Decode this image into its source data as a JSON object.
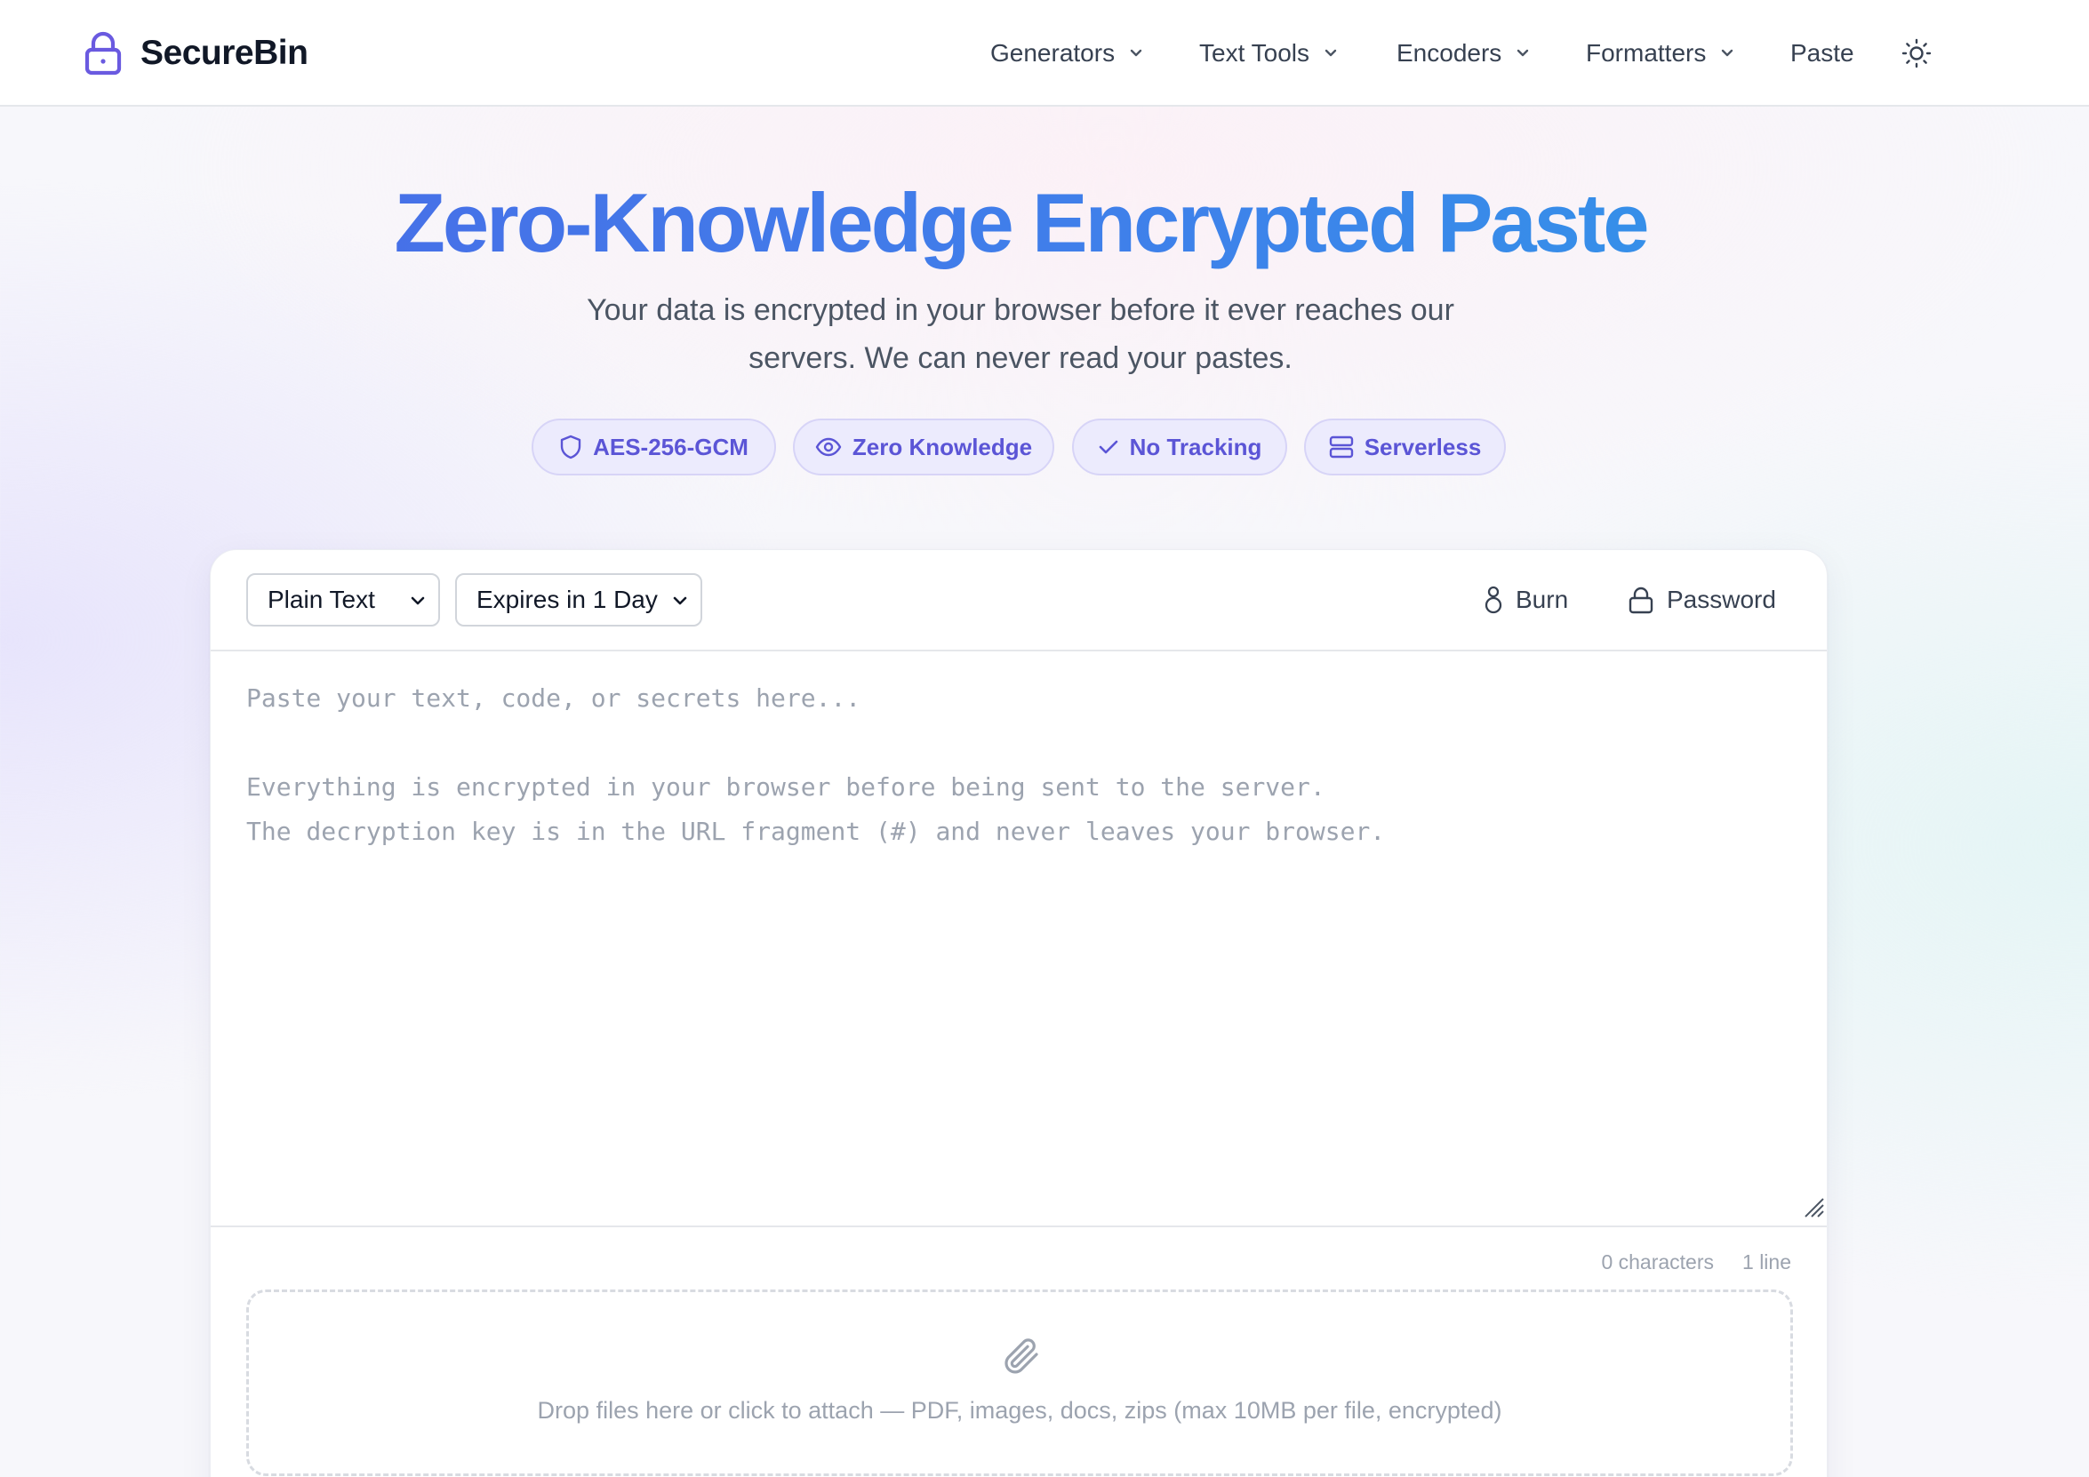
{
  "header": {
    "brand": "SecureBin",
    "nav": [
      {
        "label": "Generators",
        "has_dropdown": true
      },
      {
        "label": "Text Tools",
        "has_dropdown": true
      },
      {
        "label": "Encoders",
        "has_dropdown": true
      },
      {
        "label": "Formatters",
        "has_dropdown": true
      },
      {
        "label": "Paste",
        "has_dropdown": false
      }
    ],
    "theme_icon": "sun-icon"
  },
  "hero": {
    "title": "Zero-Knowledge Encrypted Paste",
    "subtitle_line1": "Your data is encrypted in your browser before it ever reaches our",
    "subtitle_line2": "servers. We can never read your pastes.",
    "badges": [
      {
        "label": "AES-256-GCM",
        "icon": "shield-icon"
      },
      {
        "label": "Zero Knowledge",
        "icon": "eye-icon"
      },
      {
        "label": "No Tracking",
        "icon": "check-icon"
      },
      {
        "label": "Serverless",
        "icon": "server-icon"
      }
    ]
  },
  "editor": {
    "format_select": "Plain Text",
    "expiry_select": "Expires in 1 Day",
    "burn_label": "Burn",
    "password_label": "Password",
    "value": "",
    "placeholder": "Paste your text, code, or secrets here...\n\nEverything is encrypted in your browser before being sent to the server.\nThe decryption key is in the URL fragment (#) and never leaves your browser.",
    "char_count": "0 characters",
    "line_count": "1 line",
    "dropzone_text": "Drop files here or click to attach — PDF, images, docs, zips (max 10MB per file, encrypted)"
  },
  "colors": {
    "accent": "#5b55d6",
    "badge_bg": "#ecebfd",
    "title_gradient_start": "#4a69e6",
    "title_gradient_end": "#2f9ae8"
  }
}
